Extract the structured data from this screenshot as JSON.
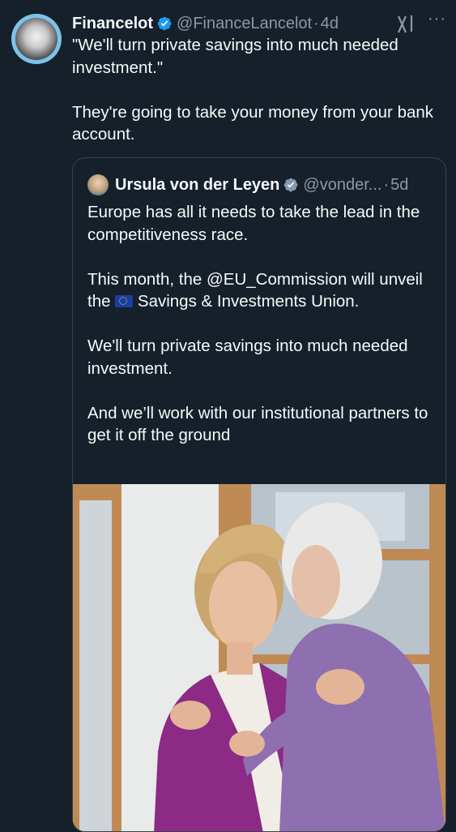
{
  "post": {
    "author_name": "Financelot",
    "author_handle": "@FinanceLancelot",
    "time": "4d",
    "separator": "·",
    "text": "\"We'll turn private savings into much needed investment.\"\n\nThey're going to take your money from your bank account.",
    "more_icon": "more-dots-icon",
    "grok_icon": "grok-icon"
  },
  "quote": {
    "author_name": "Ursula von der Leyen",
    "author_handle": "@vonder...",
    "time": "5d",
    "separator": "·",
    "text_before_flag": "Europe has all it needs to take the lead in the competitiveness race.\n\nThis month, the @EU_Commission will unveil the ",
    "text_after_flag": " Savings & Investments Union.\n\nWe'll turn private savings into much needed investment.\n\nAnd we’ll work with our institutional partners to get it off the ground"
  },
  "colors": {
    "background": "#15202b",
    "text": "#f7f9f9",
    "muted": "#8b98a5",
    "verified": "#1d9bf0",
    "border": "#38444d",
    "avatar_ring": "#7cc3ea"
  }
}
